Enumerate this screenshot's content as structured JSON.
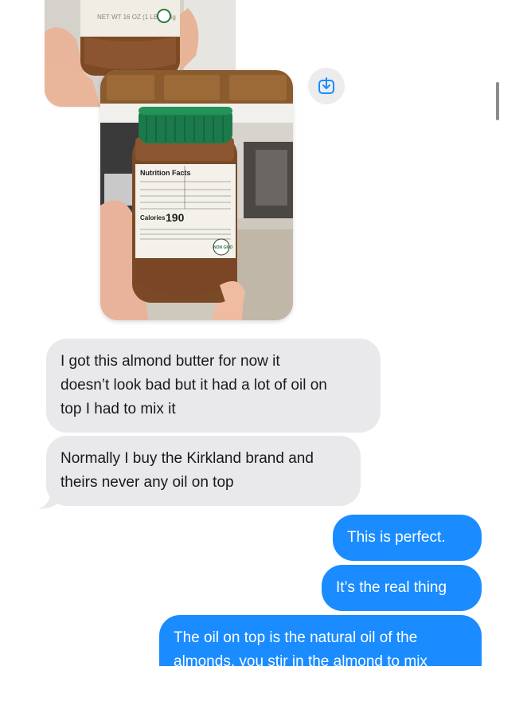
{
  "conversation": {
    "messages": [
      {
        "sender": "them",
        "text": "I got this almond butter for now it\ndoesn’t look bad but it had a lot of oil on\ntop I had to mix it"
      },
      {
        "sender": "them",
        "text": "Normally I buy the Kirkland brand and\ntheirs never any oil on top"
      },
      {
        "sender": "me",
        "text": "This is perfect."
      },
      {
        "sender": "me",
        "text": "It’s the real thing"
      },
      {
        "sender": "me",
        "text": "The oil on top is the natural oil of the\nalmonds, you stir in the almond to mix"
      }
    ]
  },
  "attachments": {
    "jar_label": {
      "title": "Nutrition Facts",
      "calories_label": "Calories",
      "calories_value": "190",
      "back_label_text": "NET WT 16 OZ (1 LB) 454g",
      "badge_text": "NON GMO"
    },
    "save_icon": "save-to-photos-icon"
  },
  "colors": {
    "sent_bubble": "#1a8cff",
    "received_bubble": "#e9e9eb",
    "jar_lid": "#1b7a4c",
    "almond_butter": "#7a4a26"
  }
}
